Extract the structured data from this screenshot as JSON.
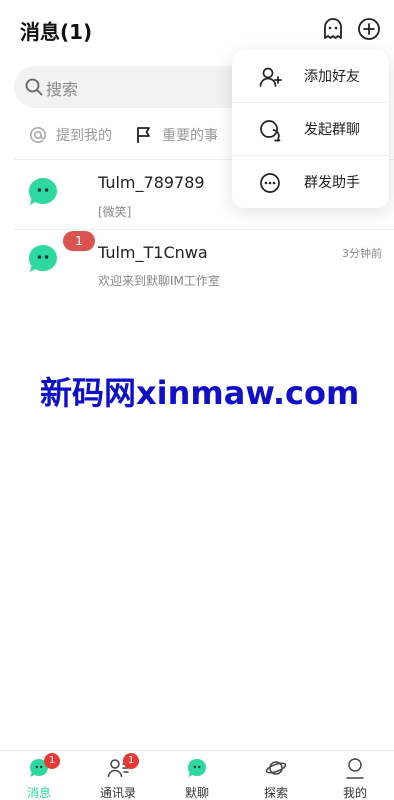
{
  "header": {
    "title": "消息(1)"
  },
  "search": {
    "placeholder": "搜索"
  },
  "filters": [
    {
      "label": "提到我的",
      "icon": "at-icon"
    },
    {
      "label": "重要的事",
      "icon": "flag-icon"
    }
  ],
  "conversations": [
    {
      "name": "Tulm_789789",
      "preview": "[微笑]",
      "time": "",
      "unread": ""
    },
    {
      "name": "Tulm_T1Cnwa",
      "preview": "欢迎来到默聊IM工作室",
      "time": "3分钟前",
      "unread": "1"
    }
  ],
  "menu": {
    "items": [
      {
        "label": "添加好友",
        "icon": "add-friend-icon"
      },
      {
        "label": "发起群聊",
        "icon": "group-chat-icon"
      },
      {
        "label": "群发助手",
        "icon": "broadcast-icon"
      }
    ]
  },
  "watermark": "新码网xinmaw.com",
  "tabbar": {
    "tabs": [
      {
        "label": "消息",
        "badge": "1",
        "icon": "chat-bubble-icon",
        "active": true
      },
      {
        "label": "通讯录",
        "badge": "1",
        "icon": "contacts-icon",
        "active": false
      },
      {
        "label": "默聊",
        "badge": "",
        "icon": "mochat-icon",
        "active": false
      },
      {
        "label": "探索",
        "badge": "",
        "icon": "planet-icon",
        "active": false
      },
      {
        "label": "我的",
        "badge": "",
        "icon": "profile-icon",
        "active": false
      }
    ]
  },
  "colors": {
    "accent_green": "#2ed8a0",
    "badge_red": "#e53935",
    "unread_pill": "#d9534f",
    "watermark_blue": "#1010c8"
  }
}
